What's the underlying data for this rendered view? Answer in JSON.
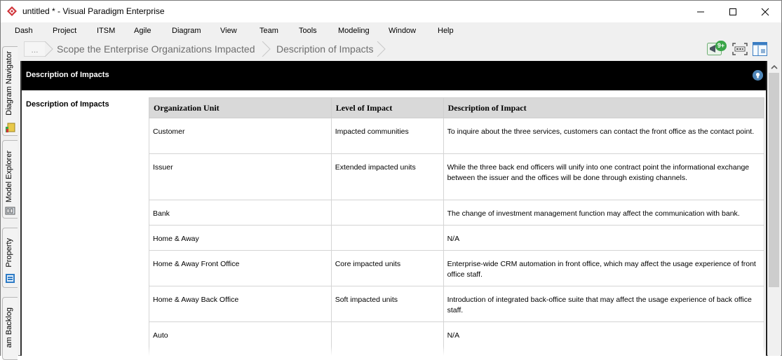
{
  "window": {
    "title": "untitled * - Visual Paradigm Enterprise",
    "controls": {
      "minimize": "minimize",
      "maximize": "maximize",
      "close": "close"
    }
  },
  "menu": [
    "Dash",
    "Project",
    "ITSM",
    "Agile",
    "Diagram",
    "View",
    "Team",
    "Tools",
    "Modeling",
    "Window",
    "Help"
  ],
  "breadcrumb": {
    "ellipsis": "...",
    "items": [
      "Scope the Enterprise Organizations Impacted",
      "Description of Impacts"
    ]
  },
  "toolbar": {
    "notification_badge": "9+"
  },
  "side_tabs": [
    "Diagram Navigator",
    "Model Explorer",
    "Property",
    "am Backlog"
  ],
  "page": {
    "header_title": "Description of Impacts",
    "section_label": "Description of Impacts"
  },
  "table": {
    "headers": [
      "Organization Unit",
      "Level of Impact",
      "Description of Impact"
    ],
    "rows": [
      [
        "Customer",
        "Impacted communities",
        "To inquire about the three services, customers can contact the front office as the contact point."
      ],
      [
        "Issuer",
        "Extended impacted units",
        "While the three back end officers will unify into one contract point the informational exchange between the issuer and the offices will be done through existing channels."
      ],
      [
        "Bank",
        "",
        "The change of investment management function may affect the communication with bank."
      ],
      [
        "Home & Away",
        "",
        "N/A"
      ],
      [
        "Home & Away Front Office",
        "Core impacted units",
        "Enterprise-wide CRM automation in front office, which may affect the usage experience of front office staff."
      ],
      [
        "Home & Away Back Office",
        "Soft impacted units",
        "Introduction of integrated back-office suite that may affect the usage experience of back office staff."
      ],
      [
        "Auto",
        "",
        "N/A"
      ]
    ]
  },
  "colors": {
    "header_bg": "#000000",
    "table_header_bg": "#d9d9d9",
    "logo": "#d0343a",
    "badge": "#3aa548"
  }
}
